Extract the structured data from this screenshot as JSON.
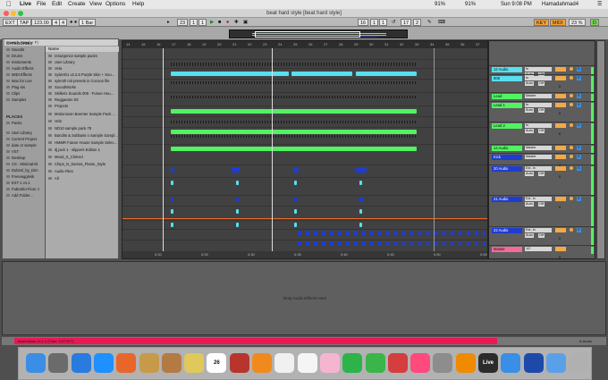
{
  "menubar": {
    "apple": "",
    "app": "Live",
    "items": [
      "File",
      "Edit",
      "Create",
      "View",
      "Options",
      "Help"
    ],
    "battery_pct": "91%",
    "battery_pct_2": "91%",
    "clock": "Sun 9:08 PM",
    "user": "Hamadahmad4"
  },
  "window": {
    "title": "beat hard style  [beat hard style]"
  },
  "transport": {
    "ext": "EXT",
    "tap": "TAP",
    "tempo": "123.00",
    "sig_num": "4",
    "sig_den": "4",
    "metro": "1 Bar",
    "pos": "23",
    "pos2": "1",
    "pos3": "1",
    "loop_start": "16",
    "loop_len": "17",
    "loop_len2": "2",
    "key": "KEY",
    "midi": "MIDI",
    "cpu": "23 %",
    "d": "D"
  },
  "browser": {
    "search_placeholder": "Search (Cmd + F)",
    "categories_title": "CATEGORIES",
    "categories": [
      "Sounds",
      "Drums",
      "Instruments",
      "Audio Effects",
      "MIDI Effects",
      "Max for Live",
      "Plug-ins",
      "Clips",
      "Samples"
    ],
    "places_title": "PLACES",
    "places": [
      "Packs",
      "User Library",
      "Current Project",
      "date or sample",
      "VST",
      "Desktop",
      "CS - Minimal-Di",
      "Dubzel_by_Dim",
      "Freeveggimik",
      "EXT 1 v1.1",
      "Fabriaho-Fiore J",
      "Add Folder..."
    ],
    "list_header": "Name",
    "list": [
      "resurgence sample packs",
      "User Library",
      "Vela",
      "Sylenth1 v2.2.6 Purple Skin + Sou...",
      "sylenth mit presets in Cocoon file",
      "SoundWorks",
      "Skillerix Sounds 008 - Future Hou...",
      "Reggaeton Kit",
      "Projects",
      "Motionsoon Bonnter Sample Pack ...",
      "Vels",
      "ND10 sample pack 78",
      "Bandits & Subbass o Sample Sampl...",
      "HMMR Future House Sample Selec...",
      "dj jack 1 - slippers Edition 1",
      "Mood_S_ChiKnd",
      "Chips_N_Samos_Flame_Style",
      "Audio Files",
      "All"
    ]
  },
  "arrangement": {
    "ruler": [
      "14",
      "15",
      "16",
      "17",
      "18",
      "19",
      "20",
      "21",
      "22",
      "23",
      "24",
      "25",
      "26",
      "27",
      "28",
      "29",
      "30",
      "31",
      "32",
      "33",
      "34",
      "35",
      "36",
      "37",
      "38"
    ],
    "time_ruler": [
      "0:20",
      "0:25",
      "0:30",
      "0:35",
      "0:40",
      "0:45",
      "0:50",
      "0:55",
      "1:00"
    ]
  },
  "mixer": {
    "tracks": [
      {
        "name": "12 Audio",
        "color": "#56e0f0",
        "in": "In",
        "auto": "Auto",
        "off": "Off",
        "vol": "0",
        "send": "S"
      },
      {
        "name": "808",
        "color": "#56e0f0",
        "in": "In",
        "auto": "Auto",
        "off": "Off",
        "vol": "0",
        "send": "S"
      },
      {
        "name": "Lead",
        "color": "#52f262",
        "in": "Master",
        "auto": "",
        "off": "",
        "vol": "0",
        "send": "S"
      },
      {
        "name": "Lead 1",
        "color": "#52f262",
        "in": "In",
        "auto": "Auto",
        "off": "Off",
        "vol": "0",
        "send": "S"
      },
      {
        "name": "Lead 2",
        "color": "#52f262",
        "in": "In",
        "auto": "Auto",
        "off": "Off",
        "vol": "0",
        "send": "S"
      },
      {
        "name": "14 Audio",
        "color": "#52f262",
        "in": "Master",
        "auto": "",
        "off": "",
        "vol": "0",
        "send": "S"
      },
      {
        "name": "Kick",
        "color": "#1f3cd0",
        "in": "Master",
        "auto": "",
        "off": "",
        "vol": "0",
        "send": "S"
      },
      {
        "name": "20 Audio",
        "color": "#1f3cd0",
        "in": "Ext. In",
        "auto": "Auto",
        "off": "Off",
        "vol": "0",
        "send": "S"
      },
      {
        "name": "21 Audio",
        "color": "#1f3cd0",
        "in": "Ext. In",
        "auto": "Auto",
        "off": "Off",
        "vol": "0",
        "send": "S"
      },
      {
        "name": "22 Audio",
        "color": "#1f3cd0",
        "in": "Ext. In",
        "auto": "Auto",
        "off": "Off",
        "vol": "0",
        "send": "S"
      },
      {
        "name": "Master",
        "color": "#f36b9c",
        "in": "1/2",
        "auto": "",
        "off": "",
        "vol": "0",
        "send": ""
      }
    ]
  },
  "detail": {
    "drop_text": "Drop Audio Effects Here"
  },
  "status": {
    "text": "Insert Mark 14.1.1 (Time: 0:27:977)",
    "right": "6-Audio"
  },
  "dock": {
    "icons": [
      "finder-icon",
      "launchpad-icon",
      "app-store-icon",
      "safari-icon",
      "firefox-icon",
      "preview-icon",
      "contacts-icon",
      "notes-icon",
      "calendar-icon",
      "dictionary-icon",
      "ibooks-icon",
      "textedit-icon",
      "reminders-icon",
      "photos-icon",
      "facetime-icon",
      "messages-icon",
      "photo-booth-icon",
      "itunes-icon",
      "system-prefs-icon",
      "vlc-icon",
      "ableton-live-icon",
      "utility-icon",
      "quicktime-icon",
      "downloads-icon",
      "trash-icon"
    ],
    "calendar_day": "26",
    "live_label": "Live"
  }
}
